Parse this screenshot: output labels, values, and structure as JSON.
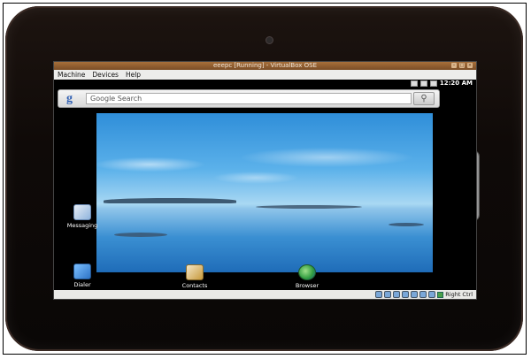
{
  "vbox_window": {
    "title": "eeepc [Running] - VirtualBox OSE",
    "menu": [
      "Machine",
      "Devices",
      "Help"
    ],
    "host_key_label": "Right Ctrl"
  },
  "android": {
    "clock": "12:20 AM",
    "search_placeholder": "Google Search",
    "google_logo": "g",
    "dock": [
      {
        "label": "Messaging",
        "icon": "messaging-icon"
      },
      {
        "label": "Dialer",
        "icon": "dialer-icon"
      },
      {
        "label": "Contacts",
        "icon": "contacts-icon"
      },
      {
        "label": "Browser",
        "icon": "browser-icon"
      }
    ]
  },
  "colors": {
    "bezel": "#0f0a08",
    "title_bar": "#8a5a2e",
    "sky": "#5bb1ea"
  }
}
